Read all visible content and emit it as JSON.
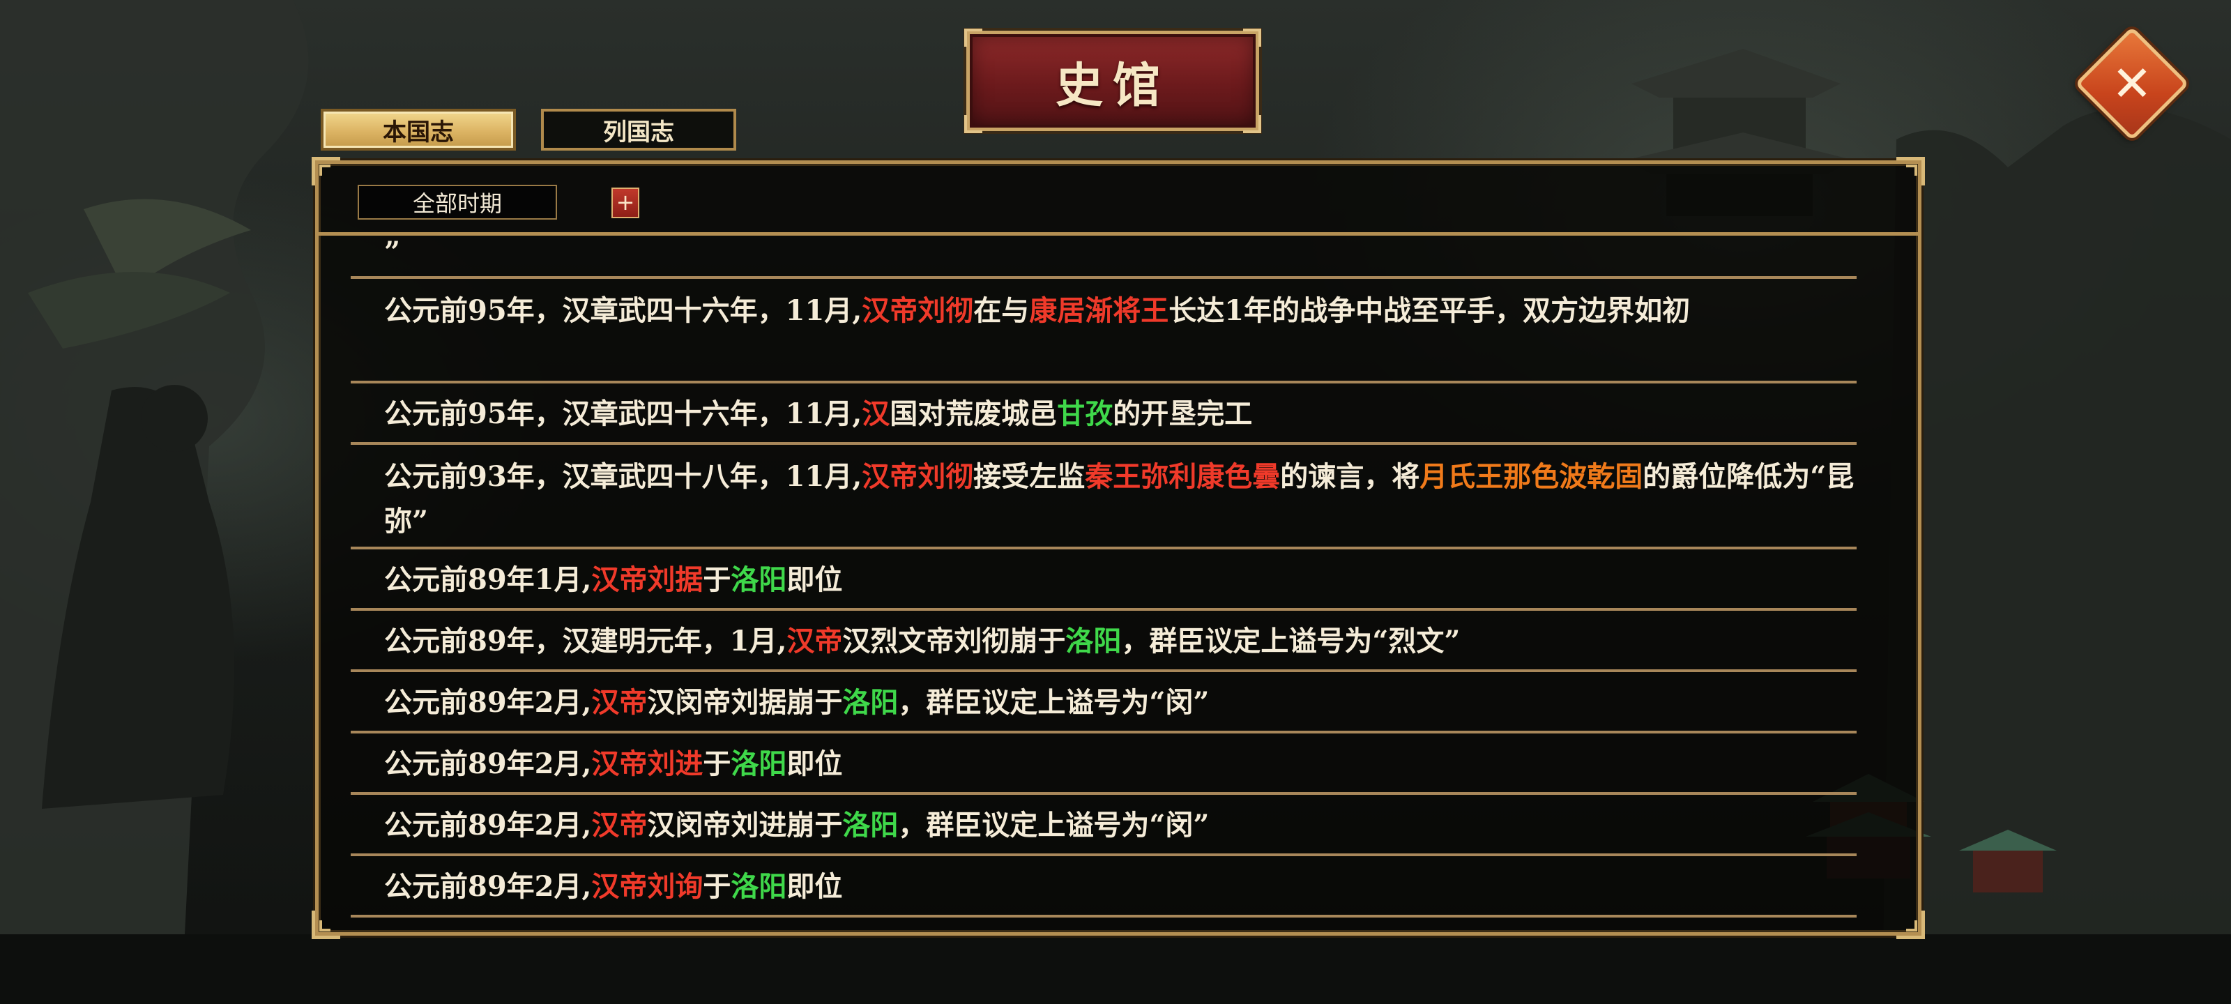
{
  "title": "史馆",
  "tabs": [
    {
      "label": "本国志",
      "active": true
    },
    {
      "label": "列国志",
      "active": false
    }
  ],
  "filter": {
    "period": "全部时期",
    "expand_label": "+"
  },
  "close_label": "✕",
  "log": {
    "partial_top": "”",
    "entries": [
      [
        {
          "t": "公元前95年，汉章武四十六年，11月,"
        },
        {
          "t": "汉帝刘彻",
          "c": "r"
        },
        {
          "t": "在与"
        },
        {
          "t": "康居渐将王",
          "c": "r"
        },
        {
          "t": "长达1年的战争中战至平手，双方边界如初"
        }
      ],
      [
        {
          "t": "公元前95年，汉章武四十六年，11月,"
        },
        {
          "t": "汉",
          "c": "r"
        },
        {
          "t": "国对荒废城邑"
        },
        {
          "t": "甘孜",
          "c": "g"
        },
        {
          "t": "的开垦完工"
        }
      ],
      [
        {
          "t": "公元前93年，汉章武四十八年，11月,"
        },
        {
          "t": "汉帝刘彻",
          "c": "r"
        },
        {
          "t": "接受左监"
        },
        {
          "t": "秦王弥利康色曇",
          "c": "r"
        },
        {
          "t": "的谏言，将"
        },
        {
          "t": "月氏王那色波乾固",
          "c": "o"
        },
        {
          "t": "的爵位降低为“昆弥”"
        }
      ],
      [
        {
          "t": "公元前89年1月,"
        },
        {
          "t": "汉帝刘据",
          "c": "r"
        },
        {
          "t": "于"
        },
        {
          "t": "洛阳",
          "c": "g"
        },
        {
          "t": "即位"
        }
      ],
      [
        {
          "t": "公元前89年，汉建明元年，1月,"
        },
        {
          "t": "汉帝",
          "c": "r"
        },
        {
          "t": "汉烈文帝刘彻崩于"
        },
        {
          "t": "洛阳",
          "c": "g"
        },
        {
          "t": "，群臣议定上谥号为“烈文”"
        }
      ],
      [
        {
          "t": "公元前89年2月,"
        },
        {
          "t": "汉帝",
          "c": "r"
        },
        {
          "t": "汉闵帝刘据崩于"
        },
        {
          "t": "洛阳",
          "c": "g"
        },
        {
          "t": "，群臣议定上谥号为“闵”"
        }
      ],
      [
        {
          "t": "公元前89年2月,"
        },
        {
          "t": "汉帝刘进",
          "c": "r"
        },
        {
          "t": "于"
        },
        {
          "t": "洛阳",
          "c": "g"
        },
        {
          "t": "即位"
        }
      ],
      [
        {
          "t": "公元前89年2月,"
        },
        {
          "t": "汉帝",
          "c": "r"
        },
        {
          "t": "汉闵帝刘进崩于"
        },
        {
          "t": "洛阳",
          "c": "g"
        },
        {
          "t": "，群臣议定上谥号为“闵”"
        }
      ],
      [
        {
          "t": "公元前89年2月,"
        },
        {
          "t": "汉帝刘询",
          "c": "r"
        },
        {
          "t": "于"
        },
        {
          "t": "洛阳",
          "c": "g"
        },
        {
          "t": "即位"
        }
      ]
    ]
  }
}
